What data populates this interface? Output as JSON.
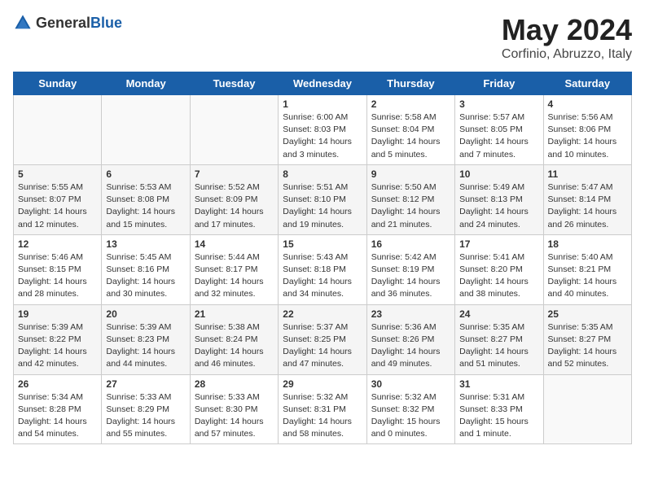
{
  "header": {
    "logo_general": "General",
    "logo_blue": "Blue",
    "month": "May 2024",
    "location": "Corfinio, Abruzzo, Italy"
  },
  "weekdays": [
    "Sunday",
    "Monday",
    "Tuesday",
    "Wednesday",
    "Thursday",
    "Friday",
    "Saturday"
  ],
  "weeks": [
    [
      {
        "day": "",
        "content": ""
      },
      {
        "day": "",
        "content": ""
      },
      {
        "day": "",
        "content": ""
      },
      {
        "day": "1",
        "content": "Sunrise: 6:00 AM\nSunset: 8:03 PM\nDaylight: 14 hours\nand 3 minutes."
      },
      {
        "day": "2",
        "content": "Sunrise: 5:58 AM\nSunset: 8:04 PM\nDaylight: 14 hours\nand 5 minutes."
      },
      {
        "day": "3",
        "content": "Sunrise: 5:57 AM\nSunset: 8:05 PM\nDaylight: 14 hours\nand 7 minutes."
      },
      {
        "day": "4",
        "content": "Sunrise: 5:56 AM\nSunset: 8:06 PM\nDaylight: 14 hours\nand 10 minutes."
      }
    ],
    [
      {
        "day": "5",
        "content": "Sunrise: 5:55 AM\nSunset: 8:07 PM\nDaylight: 14 hours\nand 12 minutes."
      },
      {
        "day": "6",
        "content": "Sunrise: 5:53 AM\nSunset: 8:08 PM\nDaylight: 14 hours\nand 15 minutes."
      },
      {
        "day": "7",
        "content": "Sunrise: 5:52 AM\nSunset: 8:09 PM\nDaylight: 14 hours\nand 17 minutes."
      },
      {
        "day": "8",
        "content": "Sunrise: 5:51 AM\nSunset: 8:10 PM\nDaylight: 14 hours\nand 19 minutes."
      },
      {
        "day": "9",
        "content": "Sunrise: 5:50 AM\nSunset: 8:12 PM\nDaylight: 14 hours\nand 21 minutes."
      },
      {
        "day": "10",
        "content": "Sunrise: 5:49 AM\nSunset: 8:13 PM\nDaylight: 14 hours\nand 24 minutes."
      },
      {
        "day": "11",
        "content": "Sunrise: 5:47 AM\nSunset: 8:14 PM\nDaylight: 14 hours\nand 26 minutes."
      }
    ],
    [
      {
        "day": "12",
        "content": "Sunrise: 5:46 AM\nSunset: 8:15 PM\nDaylight: 14 hours\nand 28 minutes."
      },
      {
        "day": "13",
        "content": "Sunrise: 5:45 AM\nSunset: 8:16 PM\nDaylight: 14 hours\nand 30 minutes."
      },
      {
        "day": "14",
        "content": "Sunrise: 5:44 AM\nSunset: 8:17 PM\nDaylight: 14 hours\nand 32 minutes."
      },
      {
        "day": "15",
        "content": "Sunrise: 5:43 AM\nSunset: 8:18 PM\nDaylight: 14 hours\nand 34 minutes."
      },
      {
        "day": "16",
        "content": "Sunrise: 5:42 AM\nSunset: 8:19 PM\nDaylight: 14 hours\nand 36 minutes."
      },
      {
        "day": "17",
        "content": "Sunrise: 5:41 AM\nSunset: 8:20 PM\nDaylight: 14 hours\nand 38 minutes."
      },
      {
        "day": "18",
        "content": "Sunrise: 5:40 AM\nSunset: 8:21 PM\nDaylight: 14 hours\nand 40 minutes."
      }
    ],
    [
      {
        "day": "19",
        "content": "Sunrise: 5:39 AM\nSunset: 8:22 PM\nDaylight: 14 hours\nand 42 minutes."
      },
      {
        "day": "20",
        "content": "Sunrise: 5:39 AM\nSunset: 8:23 PM\nDaylight: 14 hours\nand 44 minutes."
      },
      {
        "day": "21",
        "content": "Sunrise: 5:38 AM\nSunset: 8:24 PM\nDaylight: 14 hours\nand 46 minutes."
      },
      {
        "day": "22",
        "content": "Sunrise: 5:37 AM\nSunset: 8:25 PM\nDaylight: 14 hours\nand 47 minutes."
      },
      {
        "day": "23",
        "content": "Sunrise: 5:36 AM\nSunset: 8:26 PM\nDaylight: 14 hours\nand 49 minutes."
      },
      {
        "day": "24",
        "content": "Sunrise: 5:35 AM\nSunset: 8:27 PM\nDaylight: 14 hours\nand 51 minutes."
      },
      {
        "day": "25",
        "content": "Sunrise: 5:35 AM\nSunset: 8:27 PM\nDaylight: 14 hours\nand 52 minutes."
      }
    ],
    [
      {
        "day": "26",
        "content": "Sunrise: 5:34 AM\nSunset: 8:28 PM\nDaylight: 14 hours\nand 54 minutes."
      },
      {
        "day": "27",
        "content": "Sunrise: 5:33 AM\nSunset: 8:29 PM\nDaylight: 14 hours\nand 55 minutes."
      },
      {
        "day": "28",
        "content": "Sunrise: 5:33 AM\nSunset: 8:30 PM\nDaylight: 14 hours\nand 57 minutes."
      },
      {
        "day": "29",
        "content": "Sunrise: 5:32 AM\nSunset: 8:31 PM\nDaylight: 14 hours\nand 58 minutes."
      },
      {
        "day": "30",
        "content": "Sunrise: 5:32 AM\nSunset: 8:32 PM\nDaylight: 15 hours\nand 0 minutes."
      },
      {
        "day": "31",
        "content": "Sunrise: 5:31 AM\nSunset: 8:33 PM\nDaylight: 15 hours\nand 1 minute."
      },
      {
        "day": "",
        "content": ""
      }
    ]
  ]
}
